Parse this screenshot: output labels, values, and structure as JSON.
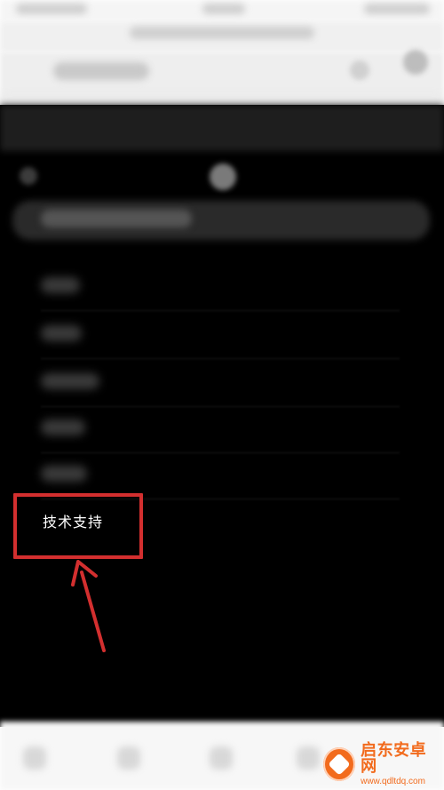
{
  "menu": {
    "highlighted_item": {
      "label": "技术支持"
    }
  },
  "annotation": {
    "box_color": "#d32f2f",
    "arrow_color": "#d32f2f"
  },
  "watermark": {
    "name": "启东安卓网",
    "url": "www.qdltdq.com",
    "brand_color": "#f26b1d"
  }
}
